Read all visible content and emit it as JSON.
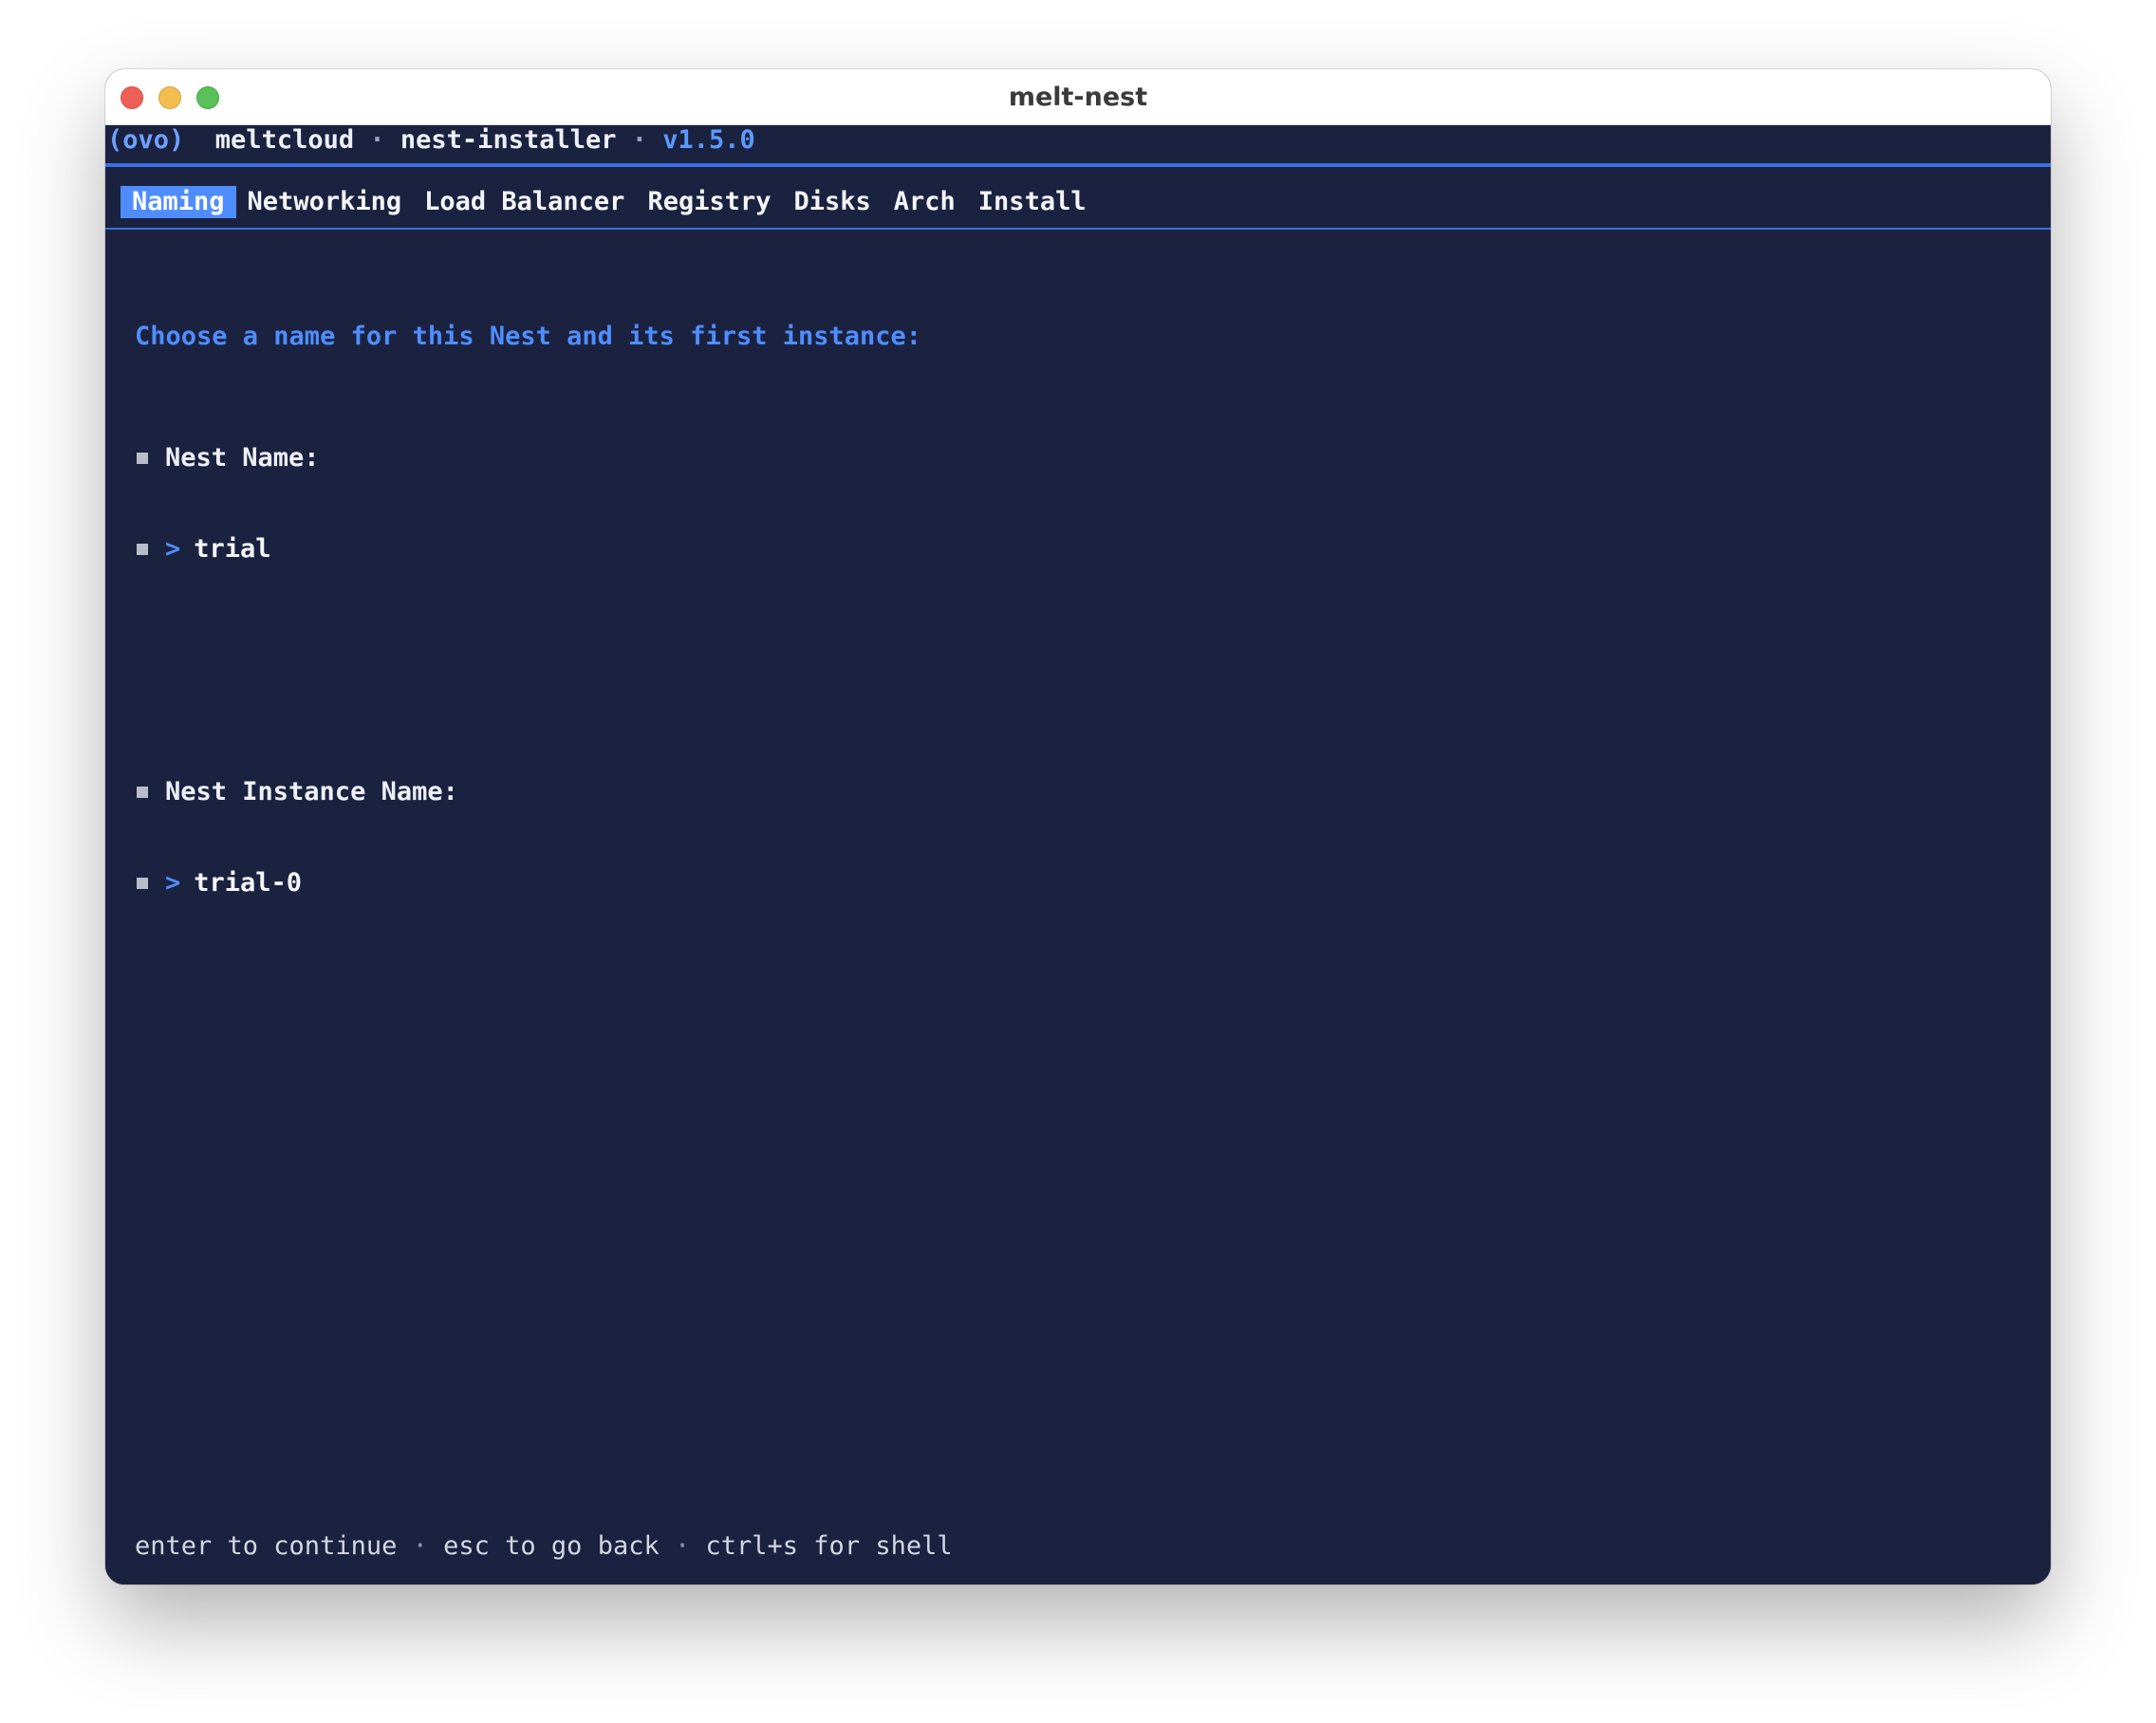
{
  "window": {
    "title": "melt-nest"
  },
  "header": {
    "face": "(ovo)",
    "brand": "meltcloud",
    "separator": "·",
    "app": "nest-installer",
    "version": "v1.5.0"
  },
  "tabs": [
    {
      "label": "Naming"
    },
    {
      "label": "Networking"
    },
    {
      "label": "Load Balancer"
    },
    {
      "label": "Registry"
    },
    {
      "label": "Disks"
    },
    {
      "label": "Arch"
    },
    {
      "label": "Install"
    }
  ],
  "form": {
    "prompt": "Choose a name for this Nest and its first instance:",
    "nest_name_label": "Nest Name:",
    "nest_name_value": "trial",
    "instance_name_label": "Nest Instance Name:",
    "instance_name_value": "trial-0",
    "chevron": ">"
  },
  "footer": {
    "enter": "enter to continue",
    "esc": "esc to go back",
    "shell": "ctrl+s for shell",
    "separator": "·"
  },
  "colors": {
    "terminal_bg": "#1b2240",
    "accent": "#4f8dff",
    "text": "#eef0f7"
  }
}
